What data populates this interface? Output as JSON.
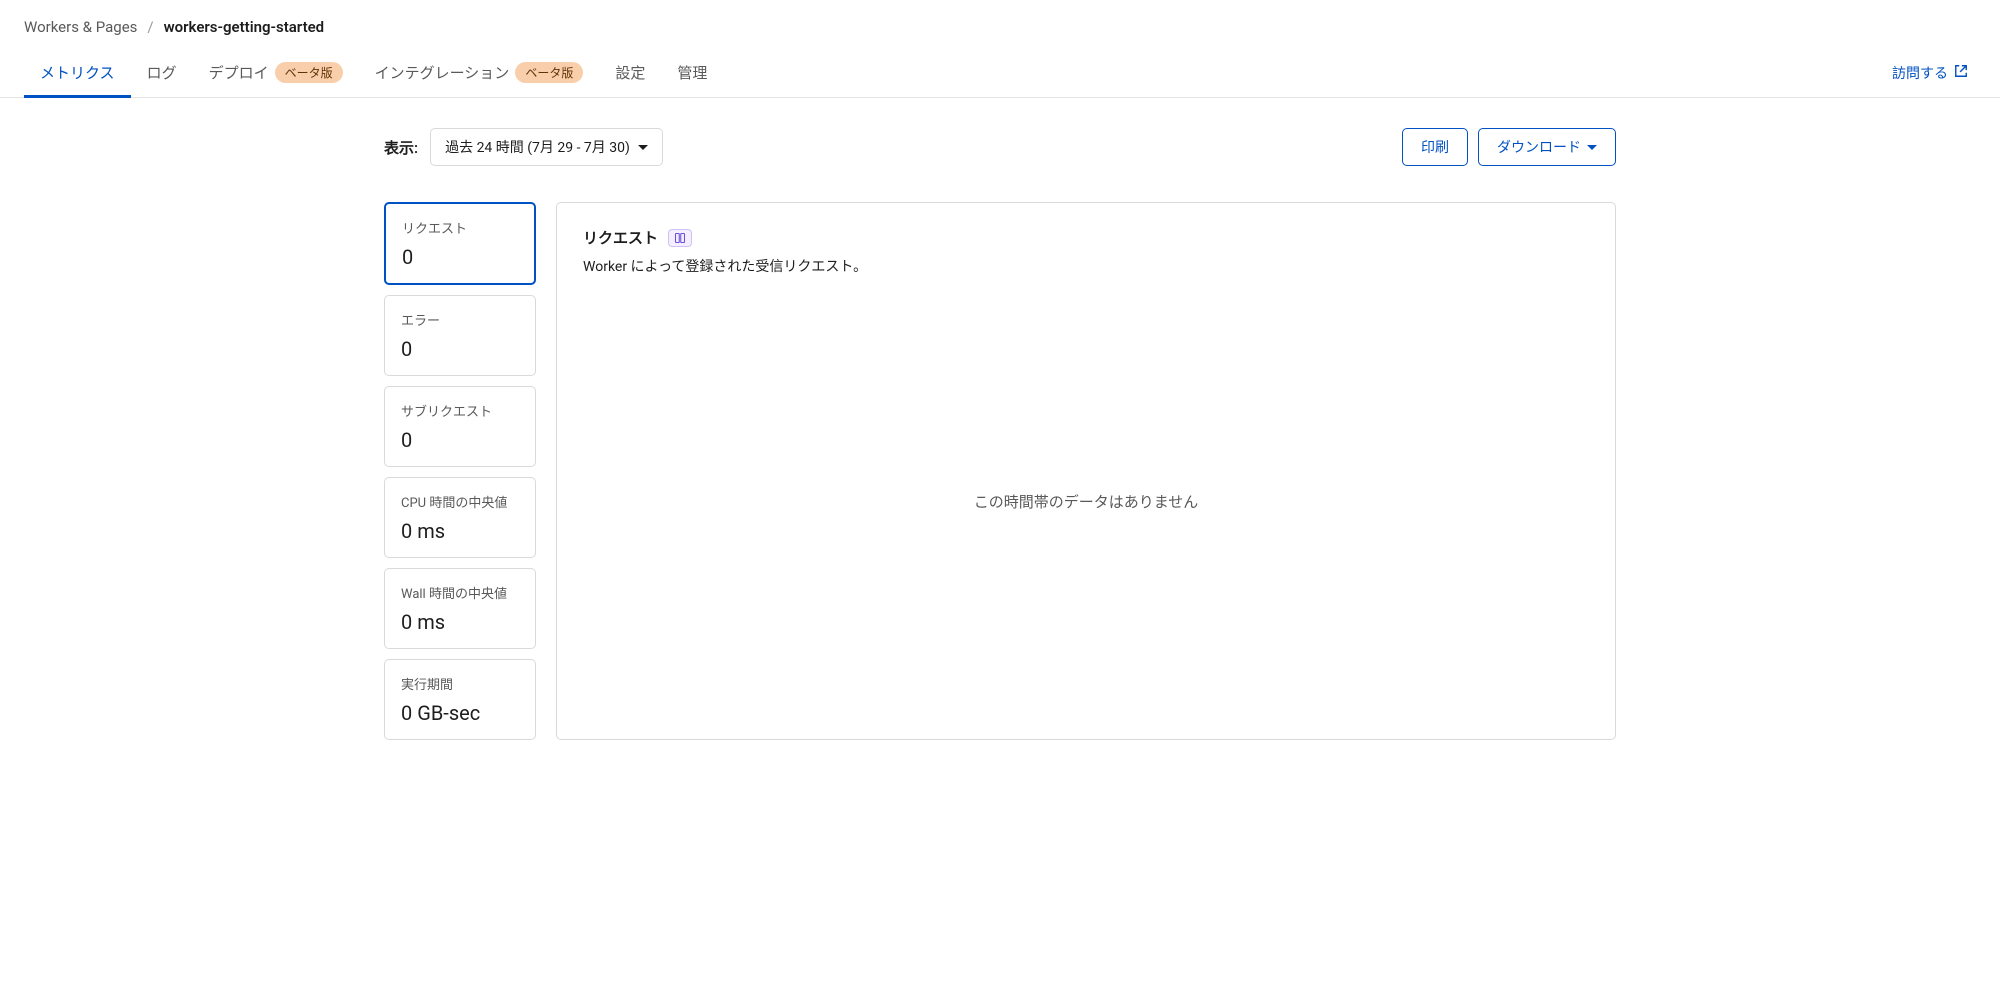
{
  "breadcrumb": {
    "parent": "Workers & Pages",
    "separator": "/",
    "current": "workers-getting-started"
  },
  "tabs": {
    "items": [
      {
        "label": "メトリクス",
        "active": true,
        "beta": false
      },
      {
        "label": "ログ",
        "active": false,
        "beta": false
      },
      {
        "label": "デプロイ",
        "active": false,
        "beta": true
      },
      {
        "label": "インテグレーション",
        "active": false,
        "beta": true
      },
      {
        "label": "設定",
        "active": false,
        "beta": false
      },
      {
        "label": "管理",
        "active": false,
        "beta": false
      }
    ],
    "beta_badge": "ベータ版"
  },
  "visit": {
    "label": "訪問する"
  },
  "toolbar": {
    "view_label": "表示:",
    "range_value": "過去 24 時間 (7月 29 - 7月 30)",
    "print_label": "印刷",
    "download_label": "ダウンロード"
  },
  "metrics": {
    "cards": [
      {
        "label": "リクエスト",
        "value": "0",
        "active": true
      },
      {
        "label": "エラー",
        "value": "0",
        "active": false
      },
      {
        "label": "サブリクエスト",
        "value": "0",
        "active": false
      },
      {
        "label": "CPU 時間の中央値",
        "value": "0 ms",
        "active": false
      },
      {
        "label": "Wall 時間の中央値",
        "value": "0 ms",
        "active": false
      },
      {
        "label": "実行期間",
        "value": "0 GB-sec",
        "active": false
      }
    ]
  },
  "chart": {
    "title": "リクエスト",
    "description": "Worker によって登録された受信リクエスト。",
    "empty_message": "この時間帯のデータはありません"
  }
}
